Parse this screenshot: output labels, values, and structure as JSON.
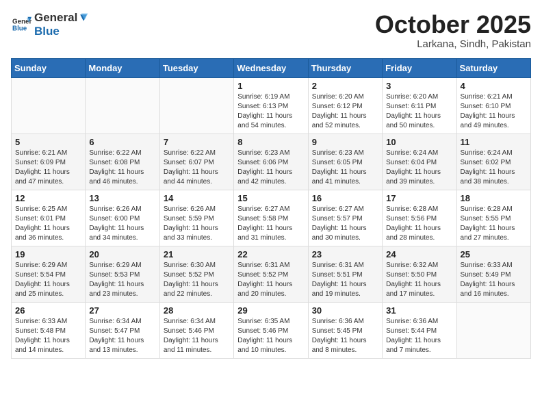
{
  "header": {
    "logo_general": "General",
    "logo_blue": "Blue",
    "month": "October 2025",
    "location": "Larkana, Sindh, Pakistan"
  },
  "weekdays": [
    "Sunday",
    "Monday",
    "Tuesday",
    "Wednesday",
    "Thursday",
    "Friday",
    "Saturday"
  ],
  "weeks": [
    [
      {
        "day": "",
        "info": ""
      },
      {
        "day": "",
        "info": ""
      },
      {
        "day": "",
        "info": ""
      },
      {
        "day": "1",
        "info": "Sunrise: 6:19 AM\nSunset: 6:13 PM\nDaylight: 11 hours\nand 54 minutes."
      },
      {
        "day": "2",
        "info": "Sunrise: 6:20 AM\nSunset: 6:12 PM\nDaylight: 11 hours\nand 52 minutes."
      },
      {
        "day": "3",
        "info": "Sunrise: 6:20 AM\nSunset: 6:11 PM\nDaylight: 11 hours\nand 50 minutes."
      },
      {
        "day": "4",
        "info": "Sunrise: 6:21 AM\nSunset: 6:10 PM\nDaylight: 11 hours\nand 49 minutes."
      }
    ],
    [
      {
        "day": "5",
        "info": "Sunrise: 6:21 AM\nSunset: 6:09 PM\nDaylight: 11 hours\nand 47 minutes."
      },
      {
        "day": "6",
        "info": "Sunrise: 6:22 AM\nSunset: 6:08 PM\nDaylight: 11 hours\nand 46 minutes."
      },
      {
        "day": "7",
        "info": "Sunrise: 6:22 AM\nSunset: 6:07 PM\nDaylight: 11 hours\nand 44 minutes."
      },
      {
        "day": "8",
        "info": "Sunrise: 6:23 AM\nSunset: 6:06 PM\nDaylight: 11 hours\nand 42 minutes."
      },
      {
        "day": "9",
        "info": "Sunrise: 6:23 AM\nSunset: 6:05 PM\nDaylight: 11 hours\nand 41 minutes."
      },
      {
        "day": "10",
        "info": "Sunrise: 6:24 AM\nSunset: 6:04 PM\nDaylight: 11 hours\nand 39 minutes."
      },
      {
        "day": "11",
        "info": "Sunrise: 6:24 AM\nSunset: 6:02 PM\nDaylight: 11 hours\nand 38 minutes."
      }
    ],
    [
      {
        "day": "12",
        "info": "Sunrise: 6:25 AM\nSunset: 6:01 PM\nDaylight: 11 hours\nand 36 minutes."
      },
      {
        "day": "13",
        "info": "Sunrise: 6:26 AM\nSunset: 6:00 PM\nDaylight: 11 hours\nand 34 minutes."
      },
      {
        "day": "14",
        "info": "Sunrise: 6:26 AM\nSunset: 5:59 PM\nDaylight: 11 hours\nand 33 minutes."
      },
      {
        "day": "15",
        "info": "Sunrise: 6:27 AM\nSunset: 5:58 PM\nDaylight: 11 hours\nand 31 minutes."
      },
      {
        "day": "16",
        "info": "Sunrise: 6:27 AM\nSunset: 5:57 PM\nDaylight: 11 hours\nand 30 minutes."
      },
      {
        "day": "17",
        "info": "Sunrise: 6:28 AM\nSunset: 5:56 PM\nDaylight: 11 hours\nand 28 minutes."
      },
      {
        "day": "18",
        "info": "Sunrise: 6:28 AM\nSunset: 5:55 PM\nDaylight: 11 hours\nand 27 minutes."
      }
    ],
    [
      {
        "day": "19",
        "info": "Sunrise: 6:29 AM\nSunset: 5:54 PM\nDaylight: 11 hours\nand 25 minutes."
      },
      {
        "day": "20",
        "info": "Sunrise: 6:29 AM\nSunset: 5:53 PM\nDaylight: 11 hours\nand 23 minutes."
      },
      {
        "day": "21",
        "info": "Sunrise: 6:30 AM\nSunset: 5:52 PM\nDaylight: 11 hours\nand 22 minutes."
      },
      {
        "day": "22",
        "info": "Sunrise: 6:31 AM\nSunset: 5:52 PM\nDaylight: 11 hours\nand 20 minutes."
      },
      {
        "day": "23",
        "info": "Sunrise: 6:31 AM\nSunset: 5:51 PM\nDaylight: 11 hours\nand 19 minutes."
      },
      {
        "day": "24",
        "info": "Sunrise: 6:32 AM\nSunset: 5:50 PM\nDaylight: 11 hours\nand 17 minutes."
      },
      {
        "day": "25",
        "info": "Sunrise: 6:33 AM\nSunset: 5:49 PM\nDaylight: 11 hours\nand 16 minutes."
      }
    ],
    [
      {
        "day": "26",
        "info": "Sunrise: 6:33 AM\nSunset: 5:48 PM\nDaylight: 11 hours\nand 14 minutes."
      },
      {
        "day": "27",
        "info": "Sunrise: 6:34 AM\nSunset: 5:47 PM\nDaylight: 11 hours\nand 13 minutes."
      },
      {
        "day": "28",
        "info": "Sunrise: 6:34 AM\nSunset: 5:46 PM\nDaylight: 11 hours\nand 11 minutes."
      },
      {
        "day": "29",
        "info": "Sunrise: 6:35 AM\nSunset: 5:46 PM\nDaylight: 11 hours\nand 10 minutes."
      },
      {
        "day": "30",
        "info": "Sunrise: 6:36 AM\nSunset: 5:45 PM\nDaylight: 11 hours\nand 8 minutes."
      },
      {
        "day": "31",
        "info": "Sunrise: 6:36 AM\nSunset: 5:44 PM\nDaylight: 11 hours\nand 7 minutes."
      },
      {
        "day": "",
        "info": ""
      }
    ]
  ]
}
